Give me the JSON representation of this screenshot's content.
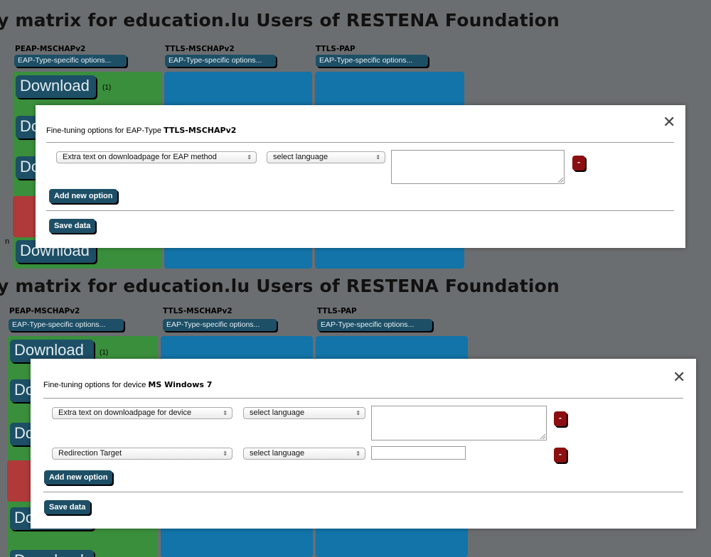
{
  "top": {
    "page_title": "y matrix for education.lu Users of RESTENA Foundation",
    "columns": [
      {
        "name": "PEAP-MSCHAPv2",
        "options_label": "EAP-Type-specific options..."
      },
      {
        "name": "TTLS-MSCHAPv2",
        "options_label": "EAP-Type-specific options..."
      },
      {
        "name": "TTLS-PAP",
        "options_label": "EAP-Type-specific options..."
      }
    ],
    "download_label": "Download",
    "download_note": "(1)",
    "download_partial_1": "Do",
    "download_partial_2": "Do",
    "download_bottom": "Download",
    "side_char": "n",
    "modal": {
      "title_prefix": "Fine-tuning options for EAP-Type",
      "title_strong": "TTLS-MSCHAPv2",
      "close_symbol": "✕",
      "rows": [
        {
          "option": "Extra text on downloadpage for EAP method",
          "language": "select language",
          "remove": "-"
        }
      ],
      "add_label": "Add new option",
      "save_label": "Save data"
    }
  },
  "bottom": {
    "page_title": "y matrix for education.lu Users of RESTENA Foundation",
    "columns": [
      {
        "name": "PEAP-MSCHAPv2",
        "options_label": "EAP-Type-specific options..."
      },
      {
        "name": "TTLS-MSCHAPv2",
        "options_label": "EAP-Type-specific options..."
      },
      {
        "name": "TTLS-PAP",
        "options_label": "EAP-Type-specific options..."
      }
    ],
    "download_label": "Download",
    "download_note": "(1)",
    "download_partial_1": "Do",
    "download_partial_2": "Do",
    "download_partial_3": "Do",
    "download_bottom": "Download",
    "modal": {
      "title_prefix": "Fine-tuning options for device",
      "title_strong": "MS Windows 7",
      "close_symbol": "✕",
      "rows": [
        {
          "option": "Extra text on downloadpage for device",
          "language": "select language",
          "remove": "-"
        },
        {
          "option": "Redirection Target",
          "language": "select language",
          "remove": "-"
        }
      ],
      "add_label": "Add new option",
      "save_label": "Save data"
    }
  },
  "icons": {
    "select_arrow": "⇕",
    "close": "close-icon"
  },
  "colors": {
    "overlay_grey": "#6b6e70",
    "green_cell": "#3a8f3c",
    "blue_cell": "#1274a8",
    "red_cell": "#b03a3a",
    "button_teal": "#1d4f66",
    "remove_red": "#8b0f10"
  }
}
